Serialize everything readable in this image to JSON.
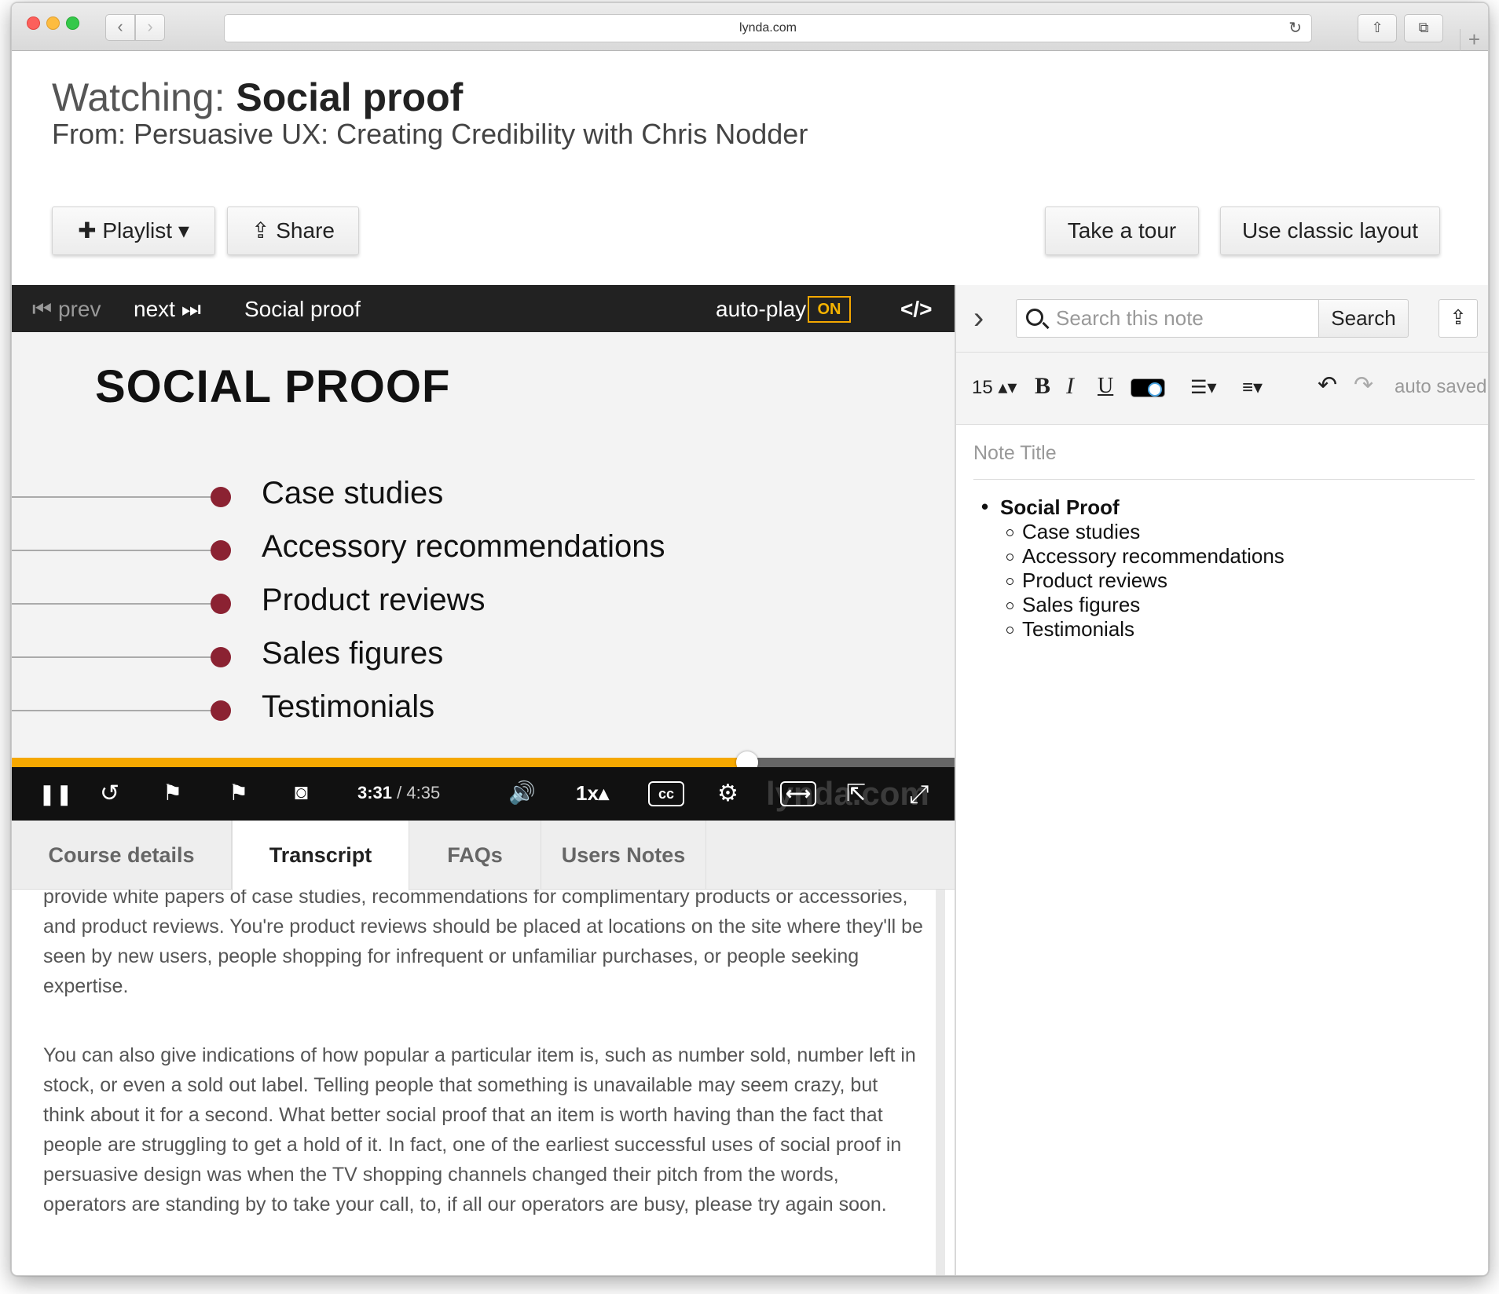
{
  "browser": {
    "url": "lynda.com",
    "back_icon": "‹",
    "forward_icon": "›",
    "reload_icon": "↻",
    "share_icon": "⇧",
    "tabs_icon": "⧉",
    "new_tab_icon": "+"
  },
  "header": {
    "watching_label": "Watching:",
    "video_title": "Social proof",
    "from_line": "From: Persuasive UX: Creating Credibility with Chris Nodder"
  },
  "actions": {
    "playlist": "✚ Playlist ▾",
    "share": "⇪ Share",
    "tour": "Take a tour",
    "classic": "Use classic layout"
  },
  "video_bar": {
    "prev": "⏮ prev",
    "next": "next ⏭",
    "title": "Social proof",
    "autoplay": "auto-play",
    "autoplay_state": "ON",
    "embed": "</>"
  },
  "slide": {
    "title": "SOCIAL PROOF",
    "items": [
      "Case studies",
      "Accessory recommendations",
      "Product reviews",
      "Sales figures",
      "Testimonials"
    ]
  },
  "player": {
    "progress": 0.78,
    "current_time": "3:31",
    "total_time": "/ 4:35",
    "speed": "1x▴",
    "cc": "cc",
    "watermark": "lynda.com",
    "pause_icon": "❚❚",
    "replay_icon": "↺",
    "bookmark_icon": "⚑",
    "volume_icon": "🔊",
    "settings_icon": "⚙",
    "popout_icon": "⇱",
    "fullscreen_icon": "⤢"
  },
  "tabs": [
    "Course details",
    "Transcript",
    "FAQs",
    "Users Notes"
  ],
  "transcript": {
    "p1": "provide white papers of case studies, recommendations for complimentary products or accessories, and product reviews. You're product reviews should be placed at locations on the site where they'll be seen by new users, people shopping for infrequent or unfamiliar purchases, or people seeking expertise.",
    "p2": "You can also give indications of how popular a particular item is, such as number sold, number left in stock, or even a sold out label. Telling people that something is unavailable may seem crazy, but think about it for a second. What better social proof that an item is worth having than the fact that people are struggling to get a hold of it. In fact, one of the earliest successful uses of social proof in persuasive design was when the TV shopping channels changed their pitch from the words, operators are standing by to take your call, to, if all our operators are busy, please try again soon."
  },
  "notes": {
    "search_placeholder": "Search this note",
    "search_button": "Search",
    "font_size": "15 ▴▾",
    "list_icon": "☰▾",
    "align_icon": "≡▾",
    "undo_icon": "↶",
    "redo_icon": "↷",
    "saved_status": "auto saved",
    "title_placeholder": "Note Title",
    "list_heading": "Social Proof",
    "list_items": [
      "Case studies",
      "Accessory recommendations",
      "Product reviews",
      "Sales figures",
      "Testimonials"
    ]
  }
}
